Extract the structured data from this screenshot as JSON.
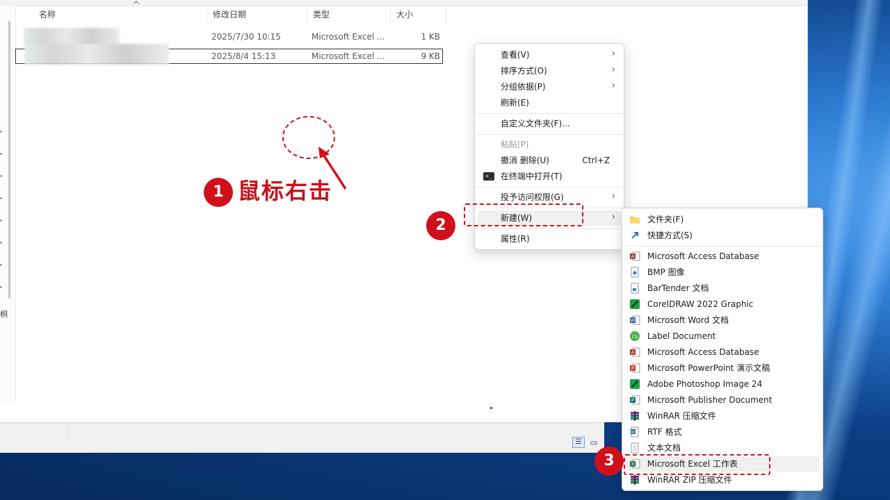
{
  "columns": {
    "name": "名称",
    "modified": "修改日期",
    "type": "类型",
    "size": "大小"
  },
  "files": [
    {
      "date": "2025/7/30 10:15",
      "type": "Microsoft Excel ...",
      "size": "1 KB"
    },
    {
      "date": "2025/8/4 15:13",
      "type": "Microsoft Excel ...",
      "size": "9 KB"
    }
  ],
  "nav": {
    "glyph": "桐"
  },
  "context_menu": {
    "view": "查看(V)",
    "sort": "排序方式(O)",
    "group": "分组依据(P)",
    "refresh": "刷新(E)",
    "customize": "自定义文件夹(F)...",
    "paste": "粘贴(P)",
    "undo": "撤消 删除(U)",
    "undo_shortcut": "Ctrl+Z",
    "terminal": "在终端中打开(T)",
    "access": "授予访问权限(G)",
    "new": "新建(W)",
    "properties": "属性(R)"
  },
  "new_submenu": [
    {
      "label": "文件夹(F)",
      "icon": "folder-icon"
    },
    {
      "label": "快捷方式(S)",
      "icon": "shortcut-icon"
    },
    {
      "label": "Microsoft Access Database",
      "icon": "access-icon"
    },
    {
      "label": "BMP 图像",
      "icon": "bmp-icon"
    },
    {
      "label": "BarTender 文档",
      "icon": "bartender-icon"
    },
    {
      "label": "CorelDRAW 2022 Graphic",
      "icon": "coreldraw-icon"
    },
    {
      "label": "Microsoft Word 文档",
      "icon": "word-icon"
    },
    {
      "label": "Label Document",
      "icon": "label-icon"
    },
    {
      "label": "Microsoft Access Database",
      "icon": "access-icon"
    },
    {
      "label": "Microsoft PowerPoint 演示文稿",
      "icon": "powerpoint-icon"
    },
    {
      "label": "Adobe Photoshop Image 24",
      "icon": "photoshop-icon"
    },
    {
      "label": "Microsoft Publisher Document",
      "icon": "publisher-icon"
    },
    {
      "label": "WinRAR 压缩文件",
      "icon": "winrar-icon"
    },
    {
      "label": "RTF 格式",
      "icon": "rtf-icon"
    },
    {
      "label": "文本文档",
      "icon": "text-icon"
    },
    {
      "label": "Microsoft Excel 工作表",
      "icon": "excel-icon"
    },
    {
      "label": "WinRAR ZIP 压缩文件",
      "icon": "winrar-zip-icon"
    }
  ],
  "annotations": {
    "step1": "1",
    "step1_text": "鼠标右击",
    "step2": "2",
    "step3": "3",
    "color": "#d0101a"
  },
  "colors": {
    "excel_green": "#1e7145",
    "word_blue": "#2b579a",
    "access_red": "#a4373a"
  }
}
